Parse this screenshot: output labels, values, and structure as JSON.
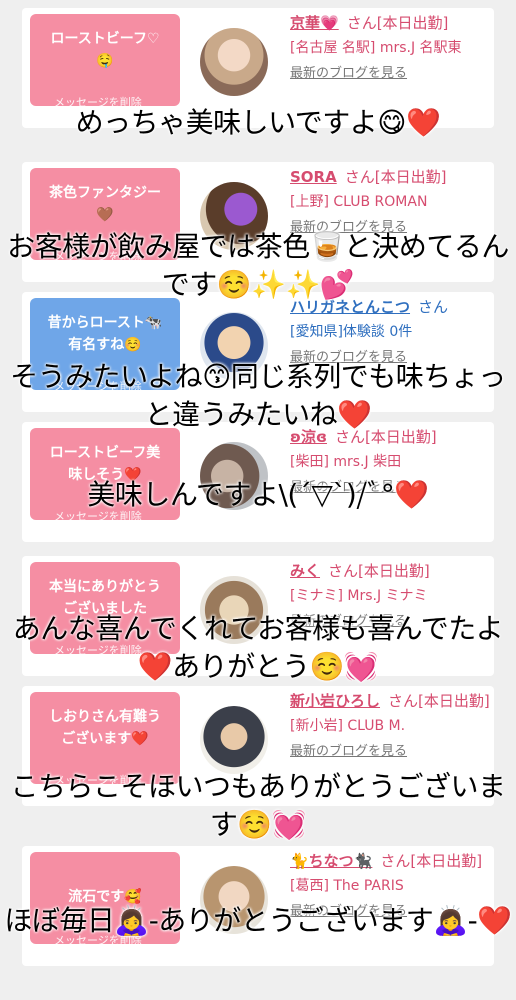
{
  "cards": [
    {
      "message": "ローストビーフ♡\n🤤",
      "bubble_color": "pink",
      "delete_label": "メッセージを削除",
      "name": "京華💗",
      "suffix": "さん[本日出勤]",
      "shop": "[名古屋 名駅] mrs.J 名駅東",
      "blog": "最新のブログを見る",
      "name_color": "pink"
    },
    {
      "message": "茶色ファンタジー\n🤎",
      "bubble_color": "pink",
      "delete_label": "メッセージを削除",
      "name": "SORA",
      "suffix": "さん[本日出勤]",
      "shop": "[上野] CLUB ROMAN",
      "blog": "最新のブログを見る",
      "name_color": "pink"
    },
    {
      "message": "昔からロースト🐄\n有名すね☺️",
      "bubble_color": "blue",
      "delete_label": "メッセージを削除",
      "name": "ハリガネとんこつ",
      "suffix": "さん",
      "shop": "[愛知県]体験談 0件",
      "blog": "最新のブログを見る",
      "name_color": "blue"
    },
    {
      "message": "ローストビーフ美\n味しそう❤️",
      "bubble_color": "pink",
      "delete_label": "メッセージを削除",
      "name": "ʚ涼ɞ",
      "suffix": "さん[本日出勤]",
      "shop": "[柴田] mrs.J 柴田",
      "blog": "最新のブログを見る",
      "name_color": "pink"
    },
    {
      "message": "本当にありがとう\nございました",
      "bubble_color": "pink",
      "delete_label": "メッセージを削除",
      "name": "みく",
      "suffix": "さん[本日出勤]",
      "shop": "[ミナミ] Mrs.J ミナミ",
      "blog": "最新のブログを見る",
      "name_color": "pink"
    },
    {
      "message": "しおりさん有難う\nございます❤️",
      "bubble_color": "pink",
      "delete_label": "メッセージを削除",
      "name": "新小岩ひろし",
      "suffix": "さん[本日出勤]",
      "shop": "[新小岩] CLUB M.",
      "blog": "最新のブログを見る",
      "name_color": "pink"
    },
    {
      "message": "流石です🥰",
      "bubble_color": "pink",
      "delete_label": "メッセージを削除",
      "name": "🐈ちなつ🐈‍⬛",
      "suffix": "さん[本日出勤]",
      "shop": "[葛西] The PARIS",
      "blog": "最新のブログを見る",
      "name_color": "pink"
    }
  ],
  "captions": [
    "めっちゃ美味しいですよ😋❤️",
    "お客様が飲み屋では茶色🥃と決めてるんです☺️✨✨💕",
    "そうみたいよね😙同じ系列でも味ちょっと違うみたいね❤️",
    "美味しんですよ\\(´▽`)/ﾞ°❤️",
    "あんな喜んでくれてお客様も喜んでたよ❤️ありがとう☺️💓",
    "こちらこそほいつもありがとうございます☺️💓",
    "ほぼ毎日🙇‍♀️-ありがとうございます🙇‍♀️-❤️"
  ],
  "colors": {
    "bubble_pink": "#f58ea3",
    "bubble_blue": "#6fa6e8",
    "name_pink": "#d64c6f",
    "name_blue": "#2f6fbf",
    "background": "#efefef"
  }
}
